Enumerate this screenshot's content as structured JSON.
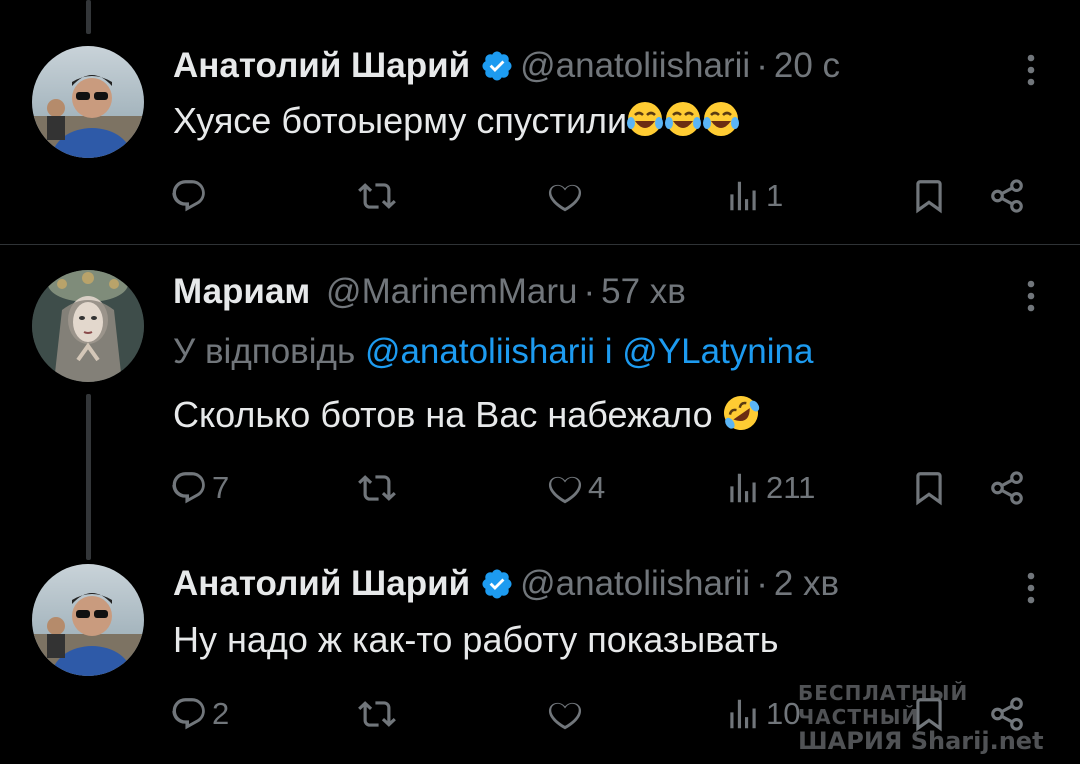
{
  "tweets": [
    {
      "author_name": "Анатолий Шарий",
      "verified": true,
      "handle": "@anatoliisharii",
      "separator": "·",
      "time": "20 с",
      "text": "Хуясе ботоыерму спустили",
      "emojis": [
        "face-with-tears-of-joy",
        "face-with-tears-of-joy",
        "face-with-tears-of-joy"
      ],
      "replies": "",
      "retweets": "",
      "likes": "",
      "views": "1"
    },
    {
      "author_name": "Мариам",
      "verified": false,
      "handle": "@MarinemMaru",
      "separator": "·",
      "time": "57 хв",
      "reply_prefix": "У відповідь",
      "reply_mention_1": "@anatoliisharii",
      "reply_conj": "і",
      "reply_mention_2": "@YLatynina",
      "text": "Сколько ботов на Вас набежало",
      "emojis": [
        "rolling-on-the-floor-laughing"
      ],
      "replies": "7",
      "retweets": "",
      "likes": "4",
      "views": "211"
    },
    {
      "author_name": "Анатолий Шарий",
      "verified": true,
      "handle": "@anatoliisharii",
      "separator": "·",
      "time": "2 хв",
      "text": "Ну надо ж как-то работу показывать",
      "emojis": [],
      "replies": "2",
      "retweets": "",
      "likes": "",
      "views": "10"
    }
  ],
  "watermark": {
    "line1": "БЕСПЛАТНЫЙ ЧАСТНЫЙ",
    "line2": "ШАРИЯ Sharij.net"
  },
  "colors": {
    "background": "#000000",
    "text": "#e7e9ea",
    "secondary": "#71767b",
    "accent": "#1d9bf0",
    "verified": "#1d9bf0",
    "divider": "#2f3336"
  }
}
